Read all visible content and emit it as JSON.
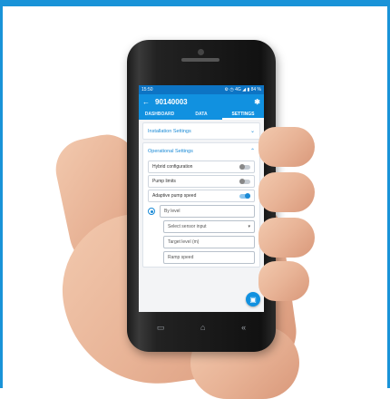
{
  "status_bar": {
    "time": "15:50",
    "indicators": "⚙ ◷ 4G ◢ ▮ 84 %"
  },
  "app_bar": {
    "back_icon": "arrow-left-icon",
    "title": "90140003",
    "bluetooth_icon": "bluetooth-icon"
  },
  "tabs": [
    {
      "label": "DASHBOARD",
      "active": false
    },
    {
      "label": "DATA",
      "active": false
    },
    {
      "label": "SETTINGS",
      "active": true
    }
  ],
  "sections": {
    "installation": {
      "label": "Installation Settings",
      "expanded": false
    },
    "operational": {
      "label": "Operational Settings",
      "expanded": true
    }
  },
  "settings": {
    "hybrid": {
      "label": "Hybrid configuration",
      "on": false
    },
    "pump_limits": {
      "label": "Pump limits",
      "on": false
    },
    "adaptive": {
      "label": "Adaptive pump speed",
      "on": true
    }
  },
  "adaptive_options": {
    "by_level": "By level",
    "sensor_select": "Select sensor input",
    "target_level": "Target level (m)",
    "ramp_speed": "Ramp speed"
  },
  "colors": {
    "accent": "#1191e0",
    "frame": "#1993d8"
  }
}
